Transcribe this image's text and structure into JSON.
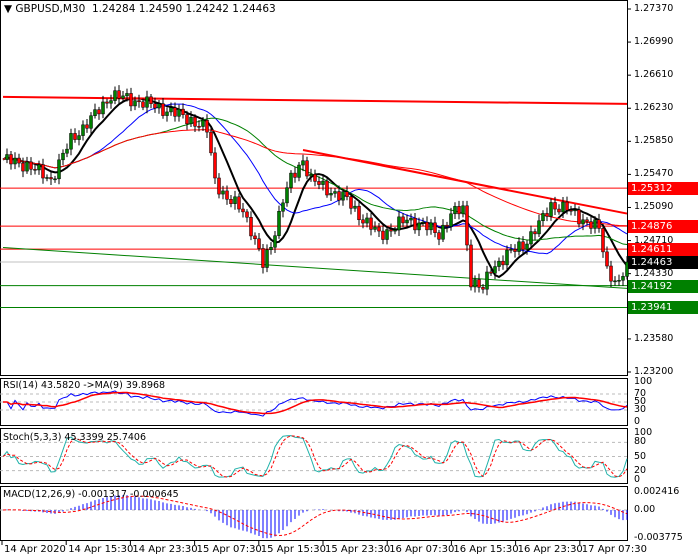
{
  "chart_data": {
    "type": "candlestick",
    "title": "GBPUSD,M30",
    "ohlc_header": [
      "1.24284",
      "1.24590",
      "1.24242",
      "1.24463"
    ],
    "ylim": [
      1.232,
      1.2737
    ],
    "y_ticks": [
      "1.27370",
      "1.26990",
      "1.26610",
      "1.26230",
      "1.25850",
      "1.25470",
      "1.25090",
      "1.24710",
      "1.24330",
      "1.23580",
      "1.23200"
    ],
    "x_ticks": [
      "14 Apr 2020",
      "14 Apr 15:30",
      "14 Apr 23:30",
      "15 Apr 07:30",
      "15 Apr 15:30",
      "15 Apr 23:30",
      "16 Apr 07:30",
      "16 Apr 15:30",
      "16 Apr 23:30",
      "17 Apr 07:30"
    ],
    "close_path": [
      [
        0,
        1.2564
      ],
      [
        6,
        1.2558
      ],
      [
        12,
        1.2541
      ],
      [
        17,
        1.2587
      ],
      [
        22,
        1.261
      ],
      [
        27,
        1.2638
      ],
      [
        32,
        1.2633
      ],
      [
        37,
        1.2627
      ],
      [
        42,
        1.2619
      ],
      [
        47,
        1.261
      ],
      [
        51,
        1.2598
      ],
      [
        53,
        1.2541
      ],
      [
        56,
        1.2518
      ],
      [
        60,
        1.2507
      ],
      [
        62,
        1.2484
      ],
      [
        65,
        1.2443
      ],
      [
        67,
        1.2466
      ],
      [
        70,
        1.2518
      ],
      [
        72,
        1.2541
      ],
      [
        75,
        1.2564
      ],
      [
        77,
        1.2541
      ],
      [
        81,
        1.253
      ],
      [
        86,
        1.2518
      ],
      [
        90,
        1.2495
      ],
      [
        94,
        1.2478
      ],
      [
        97,
        1.2484
      ],
      [
        101,
        1.2495
      ],
      [
        105,
        1.2489
      ],
      [
        109,
        1.2478
      ],
      [
        112,
        1.2501
      ],
      [
        115,
        1.2507
      ],
      [
        117,
        1.2426
      ],
      [
        120,
        1.2415
      ],
      [
        122,
        1.2438
      ],
      [
        126,
        1.2455
      ],
      [
        130,
        1.2466
      ],
      [
        134,
        1.2489
      ],
      [
        137,
        1.2512
      ],
      [
        141,
        1.2507
      ],
      [
        145,
        1.2495
      ],
      [
        149,
        1.2484
      ],
      [
        151,
        1.2438
      ],
      [
        154,
        1.242
      ],
      [
        156,
        1.2446
      ]
    ],
    "horizontal_levels": [
      {
        "price": "1.25312",
        "color": "#ff0000"
      },
      {
        "price": "1.24876",
        "color": "#ff0000"
      },
      {
        "price": "1.24611",
        "color": "#ff0000"
      },
      {
        "price": "1.24463",
        "color": "#000000",
        "current": true
      },
      {
        "price": "1.24192",
        "color": "#008000"
      },
      {
        "price": "1.23941",
        "color": "#008000"
      }
    ],
    "trendlines": [
      {
        "name": "resistance-long",
        "color": "#ff0000",
        "from": [
          0,
          1.2636
        ],
        "to": [
          156,
          1.2628
        ]
      },
      {
        "name": "resistance-down",
        "color": "#ff0000",
        "from": [
          75,
          1.2575
        ],
        "to": [
          156,
          1.2502
        ]
      },
      {
        "name": "support-green",
        "color": "#008000",
        "from": [
          0,
          1.2463
        ],
        "to": [
          156,
          1.2416
        ]
      }
    ],
    "moving_averages": [
      {
        "period": 8,
        "color": "#000000"
      },
      {
        "period": 21,
        "color": "#0000ff"
      },
      {
        "period": 40,
        "color": "#008000"
      },
      {
        "period": 90,
        "color": "#ff0000"
      }
    ],
    "colors": {
      "up": "#008000",
      "down": "#ff0000"
    },
    "indicators": {
      "rsi": {
        "label": "RSI(14) 43.5820  ->MA(9) 39.8968",
        "ticks": [
          "100",
          "70",
          "50",
          "30",
          "0"
        ]
      },
      "stoch": {
        "label": "Stoch(5,3,3) 45.3399 25.7406",
        "ticks": [
          "100",
          "80",
          "50",
          "20",
          "0"
        ]
      },
      "macd": {
        "label": "MACD(12,26,9) -0.001317 -0.000645",
        "ticks": [
          "0.002416",
          "0.00",
          "-0.003775"
        ]
      }
    }
  }
}
